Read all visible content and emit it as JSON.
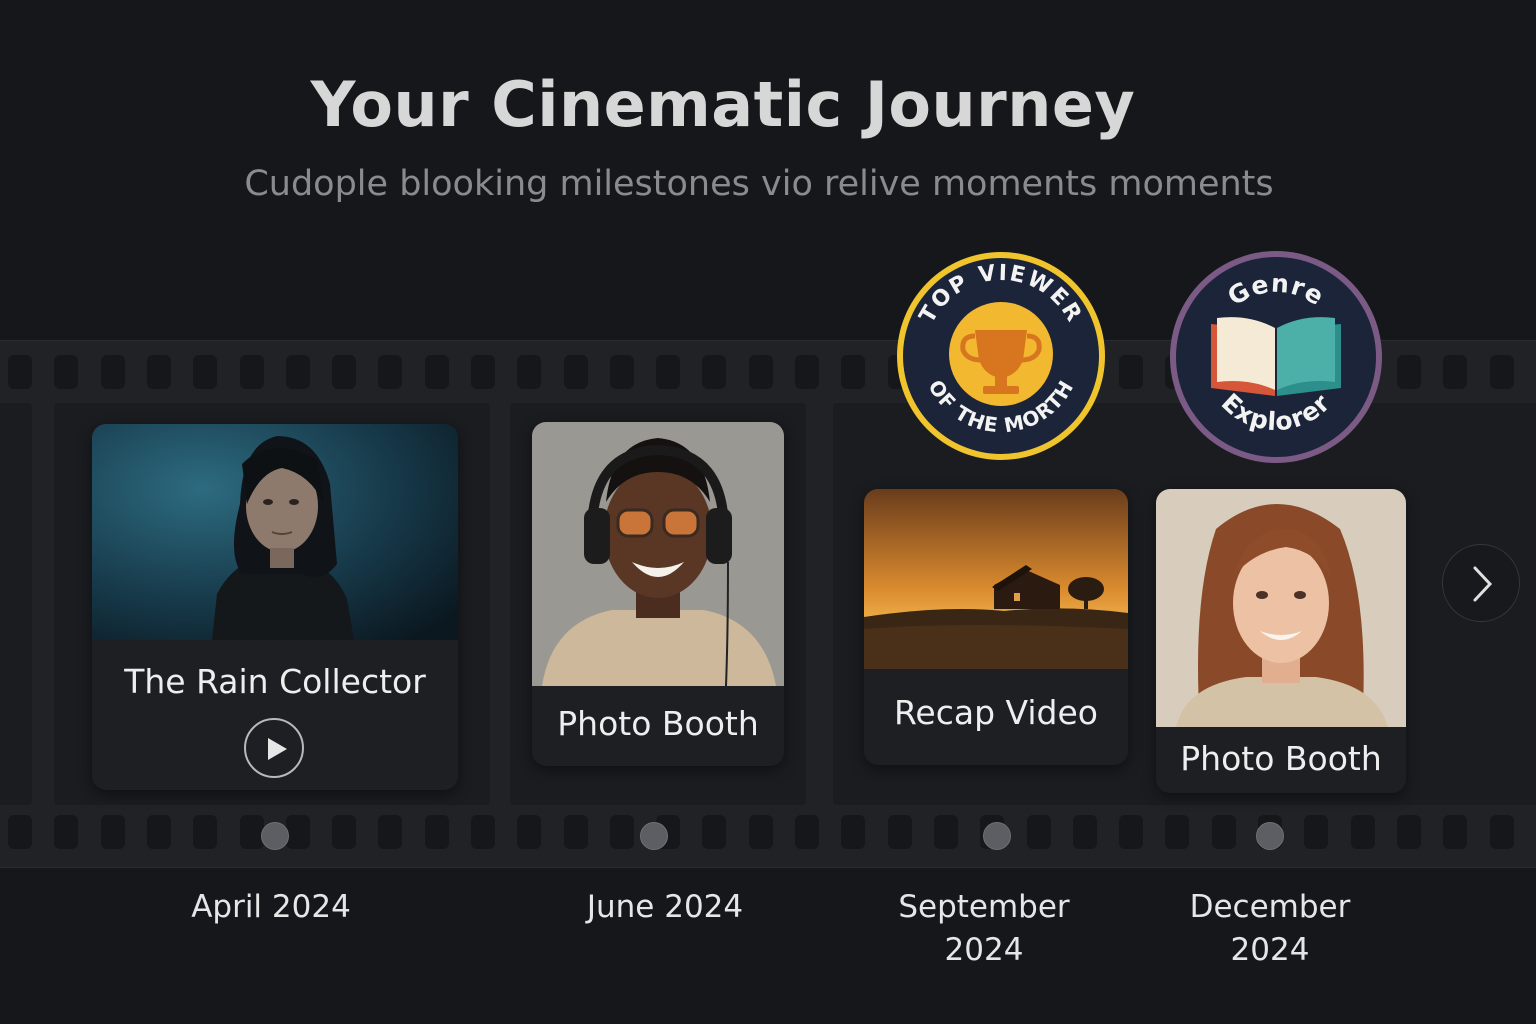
{
  "header": {
    "title": "Your Cinematic Journey",
    "subtitle": "Cudople blooking milestones  vio relive moments moments"
  },
  "milestones": [
    {
      "label": "The Rain Collector",
      "date": "April 2024",
      "has_play": true,
      "image": "woman-in-rain-portrait"
    },
    {
      "label": "Photo Booth",
      "date": "June 2024",
      "has_play": false,
      "image": "man-with-headphones-portrait"
    },
    {
      "label": "Recap Video",
      "date": "September 2024",
      "has_play": false,
      "image": "house-at-sunset"
    },
    {
      "label": "Photo Booth",
      "date": "December 2024",
      "has_play": false,
      "image": "smiling-woman-portrait"
    }
  ],
  "badges": [
    {
      "name": "top-viewer-badge",
      "text": "TOP VIEWER OF THE MORTH",
      "icon": "trophy-icon",
      "ring_color": "#f0c42c",
      "fill_color": "#1b2438"
    },
    {
      "name": "genre-explorer-badge",
      "text": "Genre Explorer",
      "icon": "open-book-icon",
      "ring_color": "#7b5a86",
      "fill_color": "#1b2438"
    }
  ],
  "colors": {
    "background": "#15171b",
    "film": "#202226",
    "card": "#1d1f23",
    "accent_gold": "#f0c42c"
  },
  "nav": {
    "next_icon": "chevron-right-icon"
  }
}
